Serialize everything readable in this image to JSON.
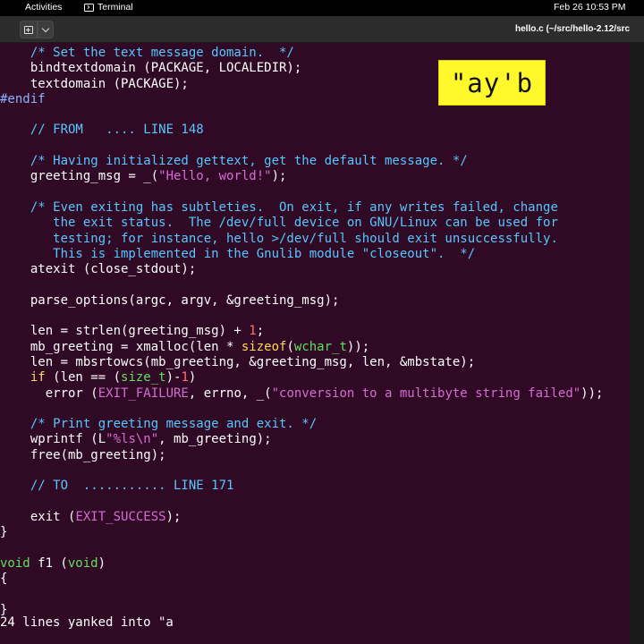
{
  "topbar": {
    "activities": "Activities",
    "app": "Terminal",
    "clock": "Feb 26  10:53 PM"
  },
  "window": {
    "title": "hello.c (~/src/hello-2.12/src"
  },
  "overlay": {
    "register_label": "\"ay'b"
  },
  "status": {
    "message": "24 lines yanked into \"a"
  },
  "code": {
    "l01": "  /* Set the text message domain.  */",
    "l02": "  bindtextdomain (PACKAGE, LOCALEDIR);",
    "l03": "  textdomain (PACKAGE);",
    "l04": "#endif",
    "l05": "",
    "l06": "  // FROM   .... LINE 148",
    "l07": "",
    "l08": "  /* Having initialized gettext, get the default message. */",
    "l09_a": "  greeting_msg = _(",
    "l09_b": "\"Hello, world!\"",
    "l09_c": ");",
    "l10": "",
    "l11": "  /* Even exiting has subtleties.  On exit, if any writes failed, change",
    "l12": "     the exit status.  The /dev/full device on GNU/Linux can be used for",
    "l13": "     testing; for instance, hello >/dev/full should exit unsuccessfully.",
    "l14": "     This is implemented in the Gnulib module \"closeout\".  */",
    "l15": "  atexit (close_stdout);",
    "l16": "",
    "l17": "  parse_options(argc, argv, &greeting_msg);",
    "l18": "",
    "l19_a": "  len = strlen(greeting_msg) + ",
    "l19_b": "1",
    "l19_c": ";",
    "l20_a": "  mb_greeting = xmalloc(len * ",
    "l20_b": "sizeof",
    "l20_c": "(",
    "l20_d": "wchar_t",
    "l20_e": "));",
    "l21": "  len = mbsrtowcs(mb_greeting, &greeting_msg, len, &mbstate);",
    "l22_a": "if",
    "l22_b": " (len == (",
    "l22_c": "size_t",
    "l22_d": ")-",
    "l22_e": "1",
    "l22_f": ")",
    "l23_a": "    error (",
    "l23_b": "EXIT_FAILURE",
    "l23_c": ", errno, _(",
    "l23_d": "\"conversion to a multibyte string failed\"",
    "l23_e": "));",
    "l24": "",
    "l25": "  /* Print greeting message and exit. */",
    "l26_a": "  wprintf (L",
    "l26_b": "\"%ls\\n\"",
    "l26_c": ", mb_greeting);",
    "l27": "  free(mb_greeting);",
    "l28": "",
    "l29": "  // TO  ........... LINE 171",
    "l30": "",
    "l31_a": "  exit (",
    "l31_b": "EXIT_SUCCESS",
    "l31_c": ");",
    "l32": "}",
    "l33": "",
    "l34_a": "void",
    "l34_b": " f1 (",
    "l34_c": "void",
    "l34_d": ")",
    "l35": "{",
    "l36": "",
    "l37": "}"
  }
}
